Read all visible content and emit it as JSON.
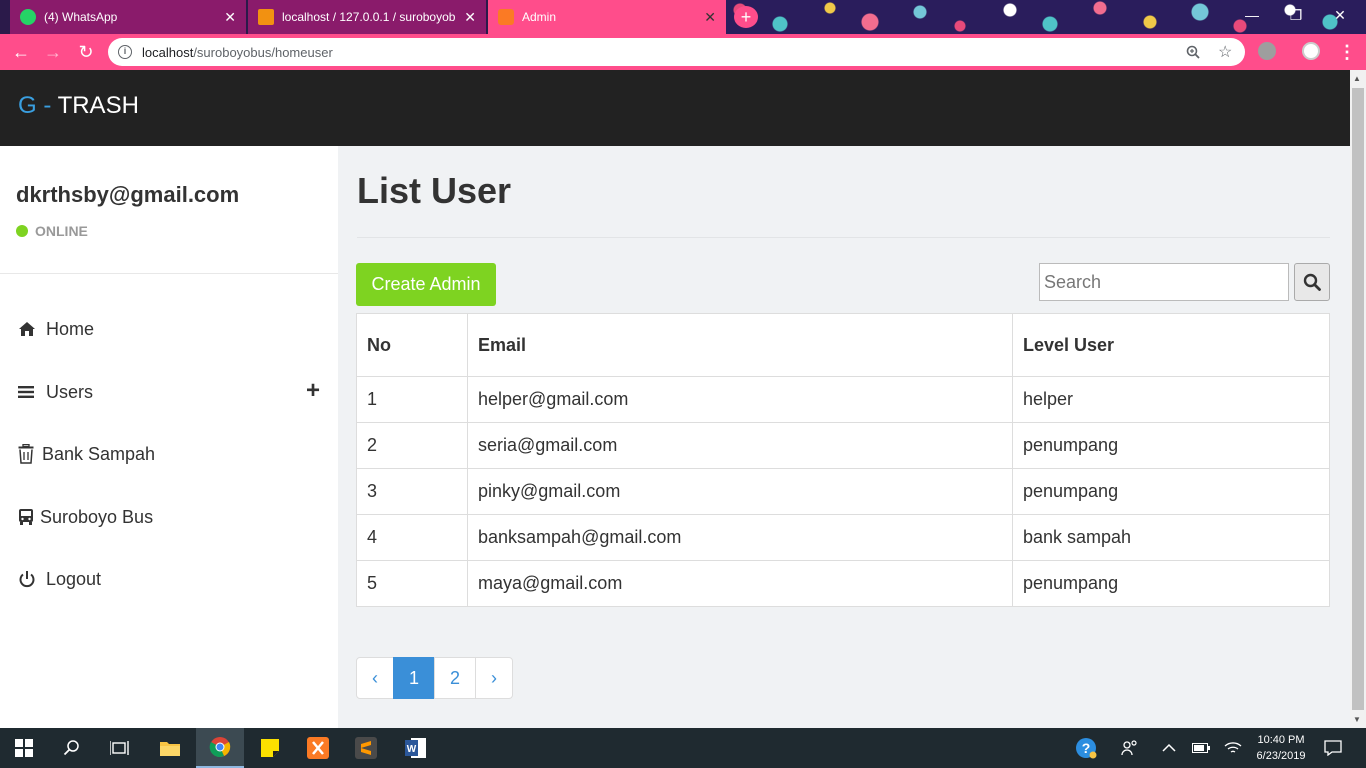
{
  "browser": {
    "tabs": [
      {
        "title": "(4) WhatsApp",
        "icon": "whatsapp-icon",
        "color": "#25d366"
      },
      {
        "title": "localhost / 127.0.0.1 / suroboyob",
        "icon": "phpmyadmin-icon",
        "color": "#f29111"
      },
      {
        "title": "Admin",
        "icon": "xampp-icon",
        "color": "#fb7a24"
      }
    ],
    "url_host": "localhost",
    "url_path": "/suroboyobus/homeuser",
    "new_tab": "+"
  },
  "app": {
    "brand_g": "G -",
    "brand_name": "TRASH"
  },
  "sidebar": {
    "user_email": "dkrthsby@gmail.com",
    "status": "ONLINE",
    "items": [
      {
        "label": "Home",
        "icon": "home-icon"
      },
      {
        "label": "Users",
        "icon": "bars-icon",
        "expand": "+"
      },
      {
        "label": "Bank Sampah",
        "icon": "trash-icon"
      },
      {
        "label": "Suroboyo Bus",
        "icon": "bus-icon"
      },
      {
        "label": "Logout",
        "icon": "power-icon"
      }
    ]
  },
  "main": {
    "title": "List User",
    "create_button": "Create Admin",
    "search_placeholder": "Search",
    "table": {
      "headers": [
        "No",
        "Email",
        "Level User"
      ],
      "rows": [
        [
          "1",
          "helper@gmail.com",
          "helper"
        ],
        [
          "2",
          "seria@gmail.com",
          "penumpang"
        ],
        [
          "3",
          "pinky@gmail.com",
          "penumpang"
        ],
        [
          "4",
          "banksampah@gmail.com",
          "bank sampah"
        ],
        [
          "5",
          "maya@gmail.com",
          "penumpang"
        ]
      ]
    },
    "pagination": {
      "prev": "‹",
      "pages": [
        "1",
        "2"
      ],
      "current_page": "1",
      "next": "›"
    }
  },
  "taskbar": {
    "time": "10:40 PM",
    "date": "6/23/2019"
  },
  "colors": {
    "accent_pink": "#ff4d8b",
    "brand_blue": "#3a9fe0",
    "create_green": "#7ed321",
    "pager_blue": "#3a8fd8"
  }
}
